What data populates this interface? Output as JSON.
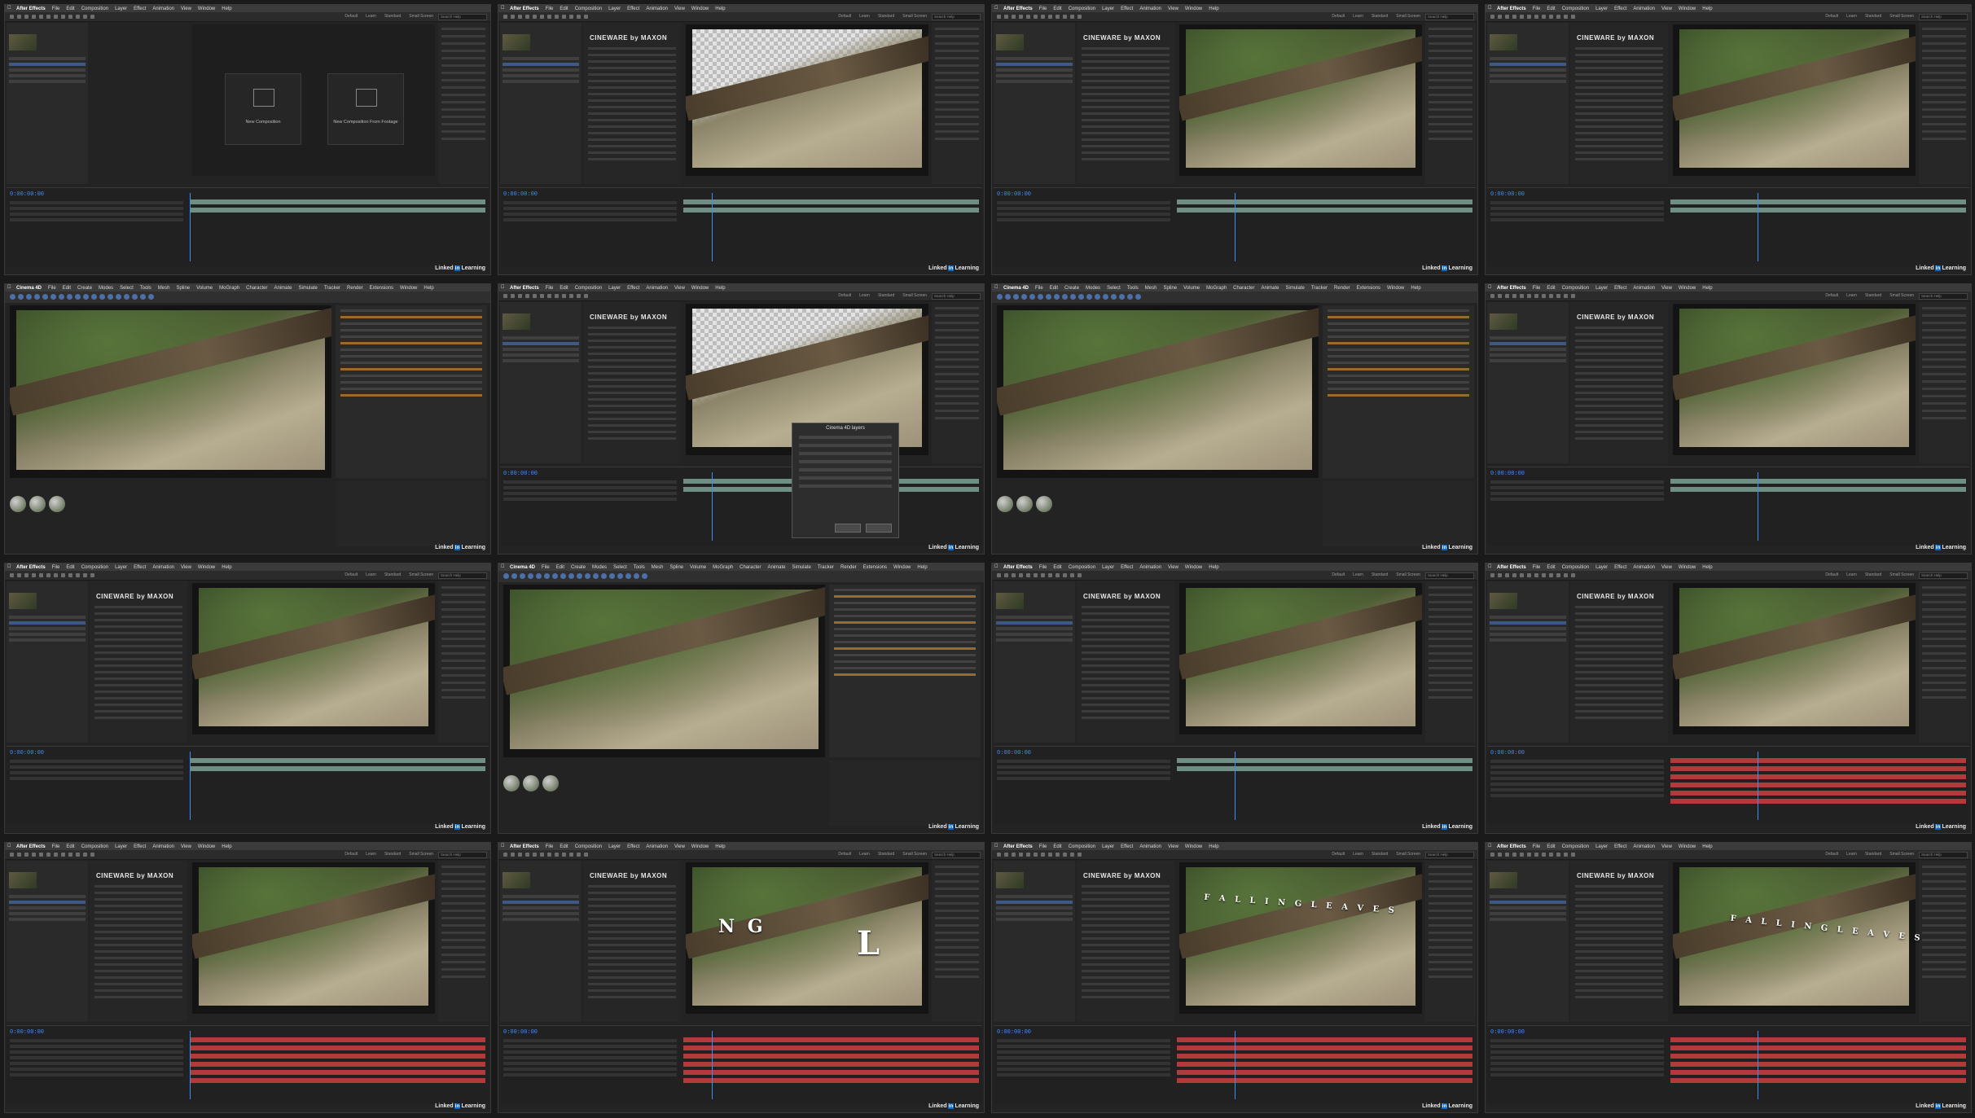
{
  "menus": {
    "ae": [
      "After Effects",
      "File",
      "Edit",
      "Composition",
      "Layer",
      "Effect",
      "Animation",
      "View",
      "Window",
      "Help"
    ],
    "c4d": [
      "Cinema 4D",
      "File",
      "Edit",
      "Create",
      "Modes",
      "Select",
      "Tools",
      "Mesh",
      "Spline",
      "Volume",
      "MoGraph",
      "Character",
      "Animate",
      "Simulate",
      "Tracker",
      "Render",
      "Extensions",
      "Window",
      "Help"
    ]
  },
  "workspaces": [
    "Default",
    "Learn",
    "Standard",
    "Small Screen"
  ],
  "search_placeholder": "Search Help",
  "effect_brand": "CINEWARE by MAXON",
  "home_tiles": [
    "New Composition",
    "New Composition From Footage"
  ],
  "timecodes": [
    "0:00:00:00",
    "0:00:00:00",
    "0:00:00:00",
    "0:00:00:00",
    "0:00:00:00",
    "0:00:00:00",
    "0:00:00:00",
    "0:00:00:00",
    "0:00:00:00",
    "0:00:00:00",
    "0:00:00:00",
    "0:00:00:00",
    "0:00:00:00",
    "0:00:00:00",
    "0:00:00:00",
    "0:00:00:00"
  ],
  "dialog_title": "Cinema 4D layers",
  "overlay_texts": [
    "N G",
    "L",
    "F A L L I N G   L E A V E S",
    "F A L L I N G   L E A V E S"
  ],
  "watermark": {
    "pre": "Linked",
    "in": "in",
    "post": "Learning"
  }
}
